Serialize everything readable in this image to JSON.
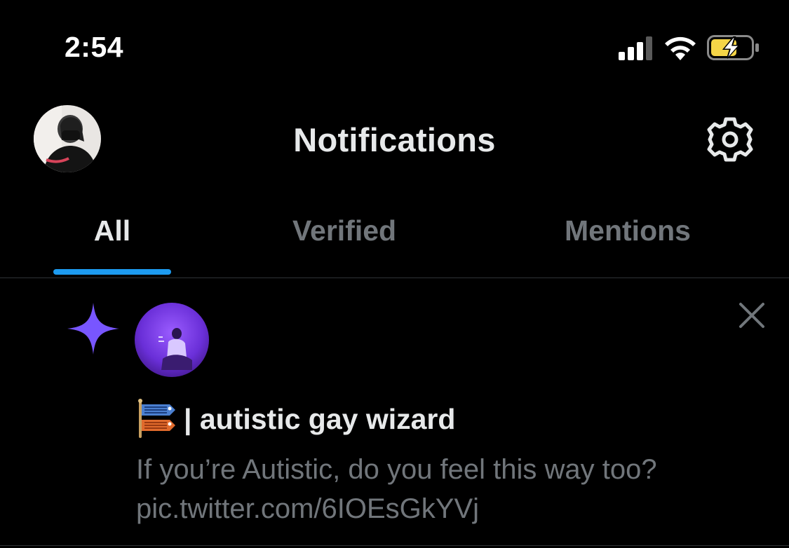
{
  "status_bar": {
    "time": "2:54",
    "signal_icon": "cellular-signal-icon",
    "wifi_icon": "wifi-icon",
    "battery_icon": "battery-charging-icon",
    "battery_color": "#f5d547"
  },
  "header": {
    "title": "Notifications",
    "avatar_icon": "profile-avatar",
    "settings_icon": "gear-icon"
  },
  "tabs": [
    {
      "label": "All",
      "active": true
    },
    {
      "label": "Verified",
      "active": false
    },
    {
      "label": "Mentions",
      "active": false
    }
  ],
  "colors": {
    "accent": "#1d9bf0",
    "sparkle": "#7856ff",
    "text_primary": "#e7e9ea",
    "text_secondary": "#71767b",
    "background": "#000000"
  },
  "notification": {
    "type_icon": "sparkle-icon",
    "author_flag_icon": "carp-streamer-icon",
    "author_name": "| autistic gay wizard",
    "text_line1": "If you’re Autistic, do you feel this way too?",
    "text_line2": "pic.twitter.com/6IOEsGkYVj",
    "dismiss_icon": "close-icon"
  }
}
